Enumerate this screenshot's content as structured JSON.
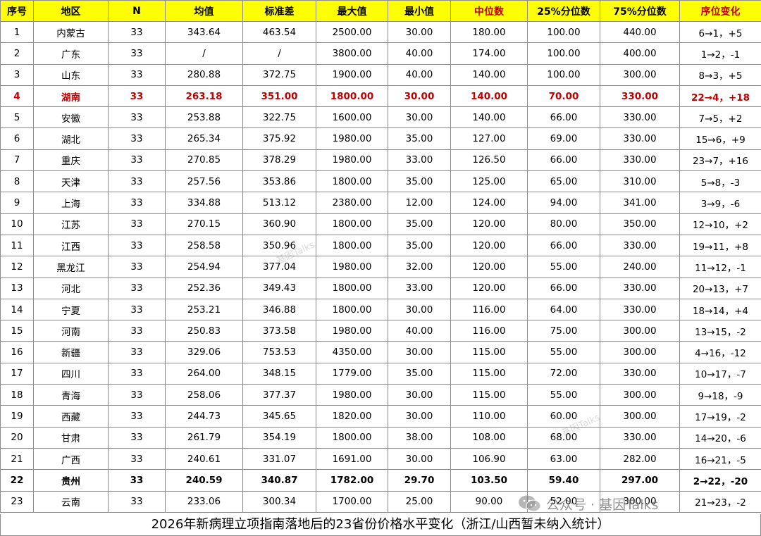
{
  "headers": [
    "序号",
    "地区",
    "N",
    "均值",
    "标准差",
    "最大值",
    "最小值",
    "中位数",
    "25%分位数",
    "75%分位数",
    "序位变化"
  ],
  "colors": {
    "header_bg": "#ffff00",
    "highlight_red": "#c00000",
    "border": "#8c8c8c"
  },
  "rows": [
    [
      "1",
      "内蒙古",
      "33",
      "343.64",
      "463.54",
      "2500.00",
      "30.00",
      "180.00",
      "100.00",
      "440.00",
      "6→1，+5"
    ],
    [
      "2",
      "广东",
      "33",
      "/",
      "/",
      "3800.00",
      "40.00",
      "174.00",
      "100.00",
      "400.00",
      "1→2，-1"
    ],
    [
      "3",
      "山东",
      "33",
      "280.88",
      "372.75",
      "1900.00",
      "40.00",
      "140.00",
      "100.00",
      "300.00",
      "8→3，+5"
    ],
    [
      "4",
      "湖南",
      "33",
      "263.18",
      "351.00",
      "1800.00",
      "30.00",
      "140.00",
      "70.00",
      "330.00",
      "22→4，+18"
    ],
    [
      "5",
      "安徽",
      "33",
      "253.88",
      "322.75",
      "1600.00",
      "30.00",
      "140.00",
      "66.00",
      "330.00",
      "7→5，+2"
    ],
    [
      "6",
      "湖北",
      "33",
      "265.34",
      "375.92",
      "1980.00",
      "35.00",
      "127.00",
      "69.00",
      "330.00",
      "15→6，+9"
    ],
    [
      "7",
      "重庆",
      "33",
      "270.85",
      "378.29",
      "1980.00",
      "33.00",
      "126.50",
      "66.00",
      "330.00",
      "23→7，+16"
    ],
    [
      "8",
      "天津",
      "33",
      "257.56",
      "353.86",
      "1800.00",
      "35.00",
      "125.00",
      "65.00",
      "310.00",
      "5→8，-3"
    ],
    [
      "9",
      "上海",
      "33",
      "334.88",
      "513.12",
      "2380.00",
      "12.00",
      "124.00",
      "94.00",
      "341.00",
      "3→9，-6"
    ],
    [
      "10",
      "江苏",
      "33",
      "270.15",
      "360.90",
      "1800.00",
      "35.00",
      "120.00",
      "80.00",
      "350.00",
      "12→10，+2"
    ],
    [
      "11",
      "江西",
      "33",
      "258.58",
      "350.96",
      "1800.00",
      "35.00",
      "120.00",
      "66.00",
      "330.00",
      "19→11，+8"
    ],
    [
      "12",
      "黑龙江",
      "33",
      "254.94",
      "377.04",
      "1980.00",
      "32.00",
      "120.00",
      "55.00",
      "240.00",
      "11→12，-1"
    ],
    [
      "13",
      "河北",
      "33",
      "252.36",
      "349.43",
      "1800.00",
      "33.00",
      "120.00",
      "66.00",
      "330.00",
      "20→13，+7"
    ],
    [
      "14",
      "宁夏",
      "33",
      "253.21",
      "346.88",
      "1800.00",
      "30.00",
      "116.00",
      "64.00",
      "330.00",
      "18→14，+4"
    ],
    [
      "15",
      "河南",
      "33",
      "250.83",
      "373.58",
      "1980.00",
      "40.00",
      "116.00",
      "75.00",
      "300.00",
      "13→15，-2"
    ],
    [
      "16",
      "新疆",
      "33",
      "329.06",
      "753.53",
      "4350.00",
      "30.00",
      "115.00",
      "55.00",
      "300.00",
      "4→16，-12"
    ],
    [
      "17",
      "四川",
      "33",
      "264.00",
      "348.15",
      "1779.00",
      "35.00",
      "115.00",
      "72.00",
      "330.00",
      "10→17，-7"
    ],
    [
      "18",
      "青海",
      "33",
      "258.06",
      "377.37",
      "1980.00",
      "30.00",
      "115.00",
      "55.00",
      "300.00",
      "9→18，-9"
    ],
    [
      "19",
      "西藏",
      "33",
      "244.73",
      "345.65",
      "1820.00",
      "30.00",
      "110.00",
      "60.00",
      "300.00",
      "17→19，-2"
    ],
    [
      "20",
      "甘肃",
      "33",
      "261.79",
      "354.19",
      "1800.00",
      "38.00",
      "108.00",
      "68.00",
      "330.00",
      "14→20，-6"
    ],
    [
      "21",
      "广西",
      "33",
      "240.61",
      "331.07",
      "1691.00",
      "30.00",
      "106.90",
      "63.00",
      "282.00",
      "16→21，-5"
    ],
    [
      "22",
      "贵州",
      "33",
      "240.59",
      "340.87",
      "1782.00",
      "29.70",
      "103.50",
      "59.40",
      "297.00",
      "2→22，-20"
    ],
    [
      "23",
      "云南",
      "33",
      "233.06",
      "300.34",
      "1700.00",
      "25.00",
      "90.00",
      "52.00",
      "300.00",
      "21→23，-2"
    ]
  ],
  "caption": "2026年新病理立项指南落地后的23省份价格水平变化（浙江/山西暂未纳入统计）",
  "watermark": {
    "small": "基因Talks",
    "brand_prefix": "公众号 · ",
    "brand_name": "基因Talks",
    "icon": "wechat-icon"
  }
}
